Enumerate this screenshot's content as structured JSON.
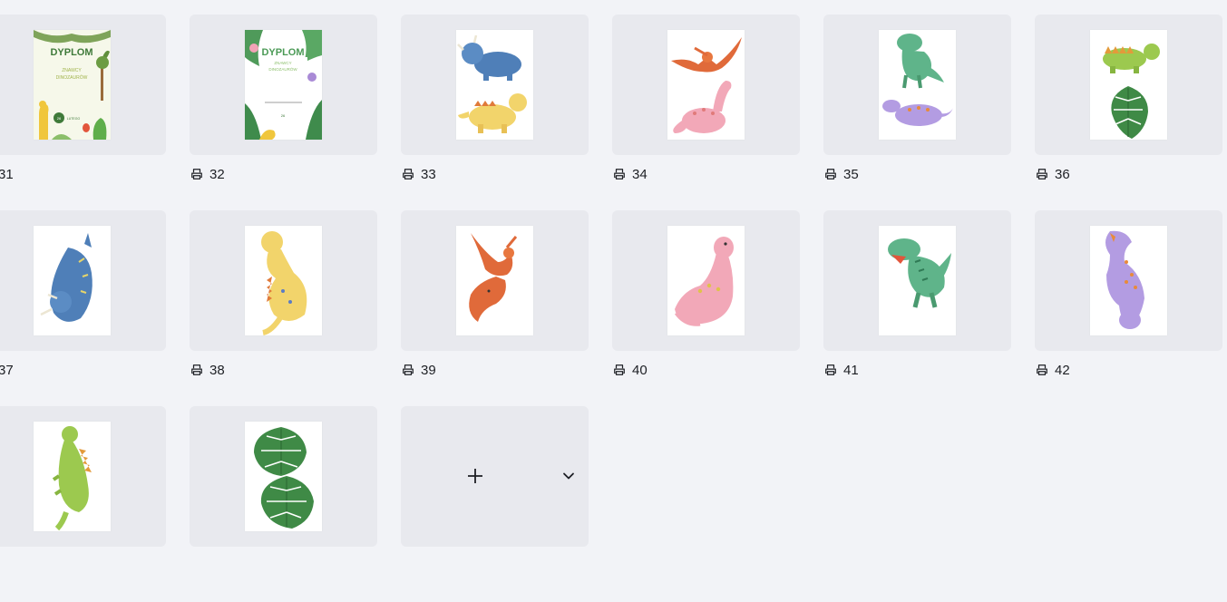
{
  "pages": [
    {
      "number": "31",
      "art": "dyplom-dino"
    },
    {
      "number": "32",
      "art": "dyplom-leaves"
    },
    {
      "number": "33",
      "art": "triceratops-and-yellow-dino"
    },
    {
      "number": "34",
      "art": "pterodactyl-and-pink-dino"
    },
    {
      "number": "35",
      "art": "trex-and-purple-dino"
    },
    {
      "number": "36",
      "art": "green-stego-and-leaf"
    },
    {
      "number": "37",
      "art": "blue-triceratops"
    },
    {
      "number": "38",
      "art": "yellow-dino"
    },
    {
      "number": "39",
      "art": "orange-pterodactyl"
    },
    {
      "number": "40",
      "art": "pink-brontosaurus"
    },
    {
      "number": "41",
      "art": "green-trex"
    },
    {
      "number": "42",
      "art": "purple-dino"
    },
    {
      "number": "",
      "art": "green-stegosaurus"
    },
    {
      "number": "",
      "art": "monstera-leaves"
    }
  ],
  "dyplom": {
    "title": "DYPLOM",
    "line1": "ZNAWCY",
    "line2": "DINOZAURÓW",
    "badge": "26",
    "month": "LUTEGO"
  },
  "icons": {
    "print": "printer-icon",
    "add": "plus-icon",
    "more": "chevron-down-icon"
  },
  "colors": {
    "background": "#f2f3f7",
    "card": "#e8e9ee",
    "text": "#1d1f24"
  }
}
